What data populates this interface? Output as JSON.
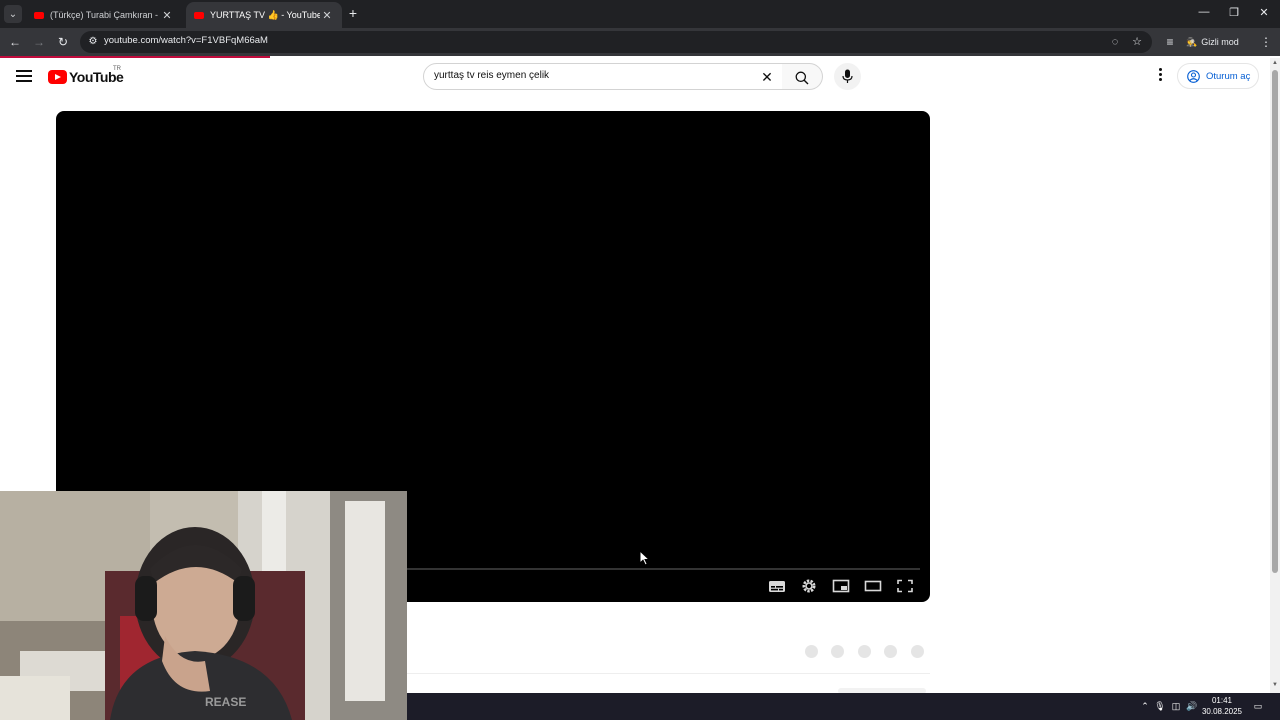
{
  "browser": {
    "tabs": [
      {
        "title": "(Türkçe) Turabi Çamkıran - Win",
        "active": false
      },
      {
        "title": "YURTTAŞ TV 👍 - YouTube",
        "active": true
      }
    ],
    "url": "youtube.com/watch?v=F1VBFqM66aM",
    "incognito_label": "Gizli mod"
  },
  "youtube": {
    "logo_text": "YouTube",
    "region": "TR",
    "search_value": "yurttaş tv reis eymen çelik",
    "signin_label": "Oturum aç"
  },
  "taskbar": {
    "time": "01:41",
    "date": "30.08.2025"
  },
  "colors": {
    "accent_red": "#ff0000",
    "link_blue": "#065fd4",
    "load_bar": "#c00b3c"
  }
}
